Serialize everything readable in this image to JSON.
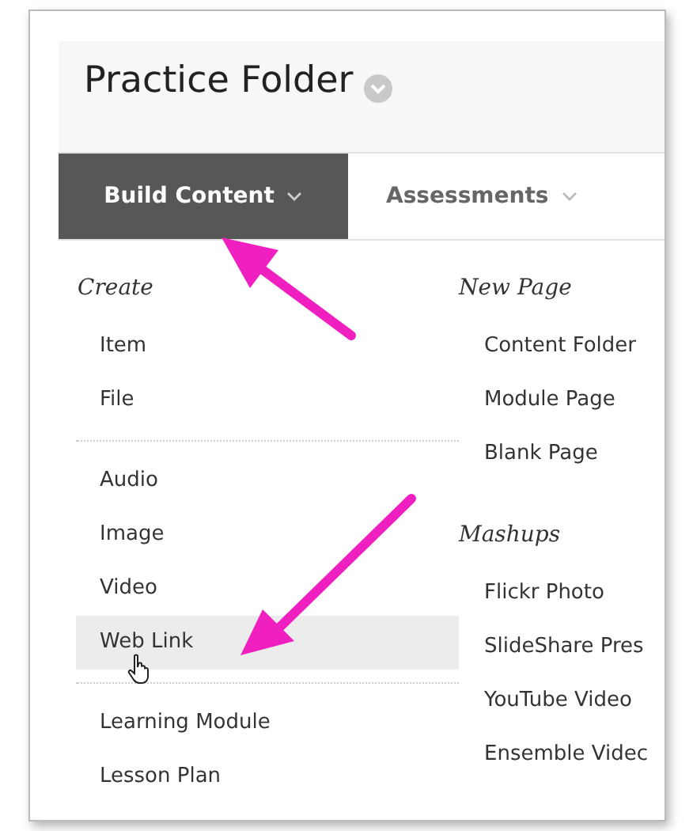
{
  "page": {
    "title": "Practice Folder"
  },
  "tabs": [
    {
      "label": "Build Content",
      "selected": true
    },
    {
      "label": "Assessments",
      "selected": false
    }
  ],
  "menu": {
    "columns": [
      {
        "divided": true,
        "sections": [
          {
            "heading": "Create",
            "items": [
              {
                "label": "Item",
                "hovered": false
              },
              {
                "label": "File",
                "hovered": false
              }
            ]
          },
          {
            "items": [
              {
                "label": "Audio",
                "hovered": false
              },
              {
                "label": "Image",
                "hovered": false
              },
              {
                "label": "Video",
                "hovered": false
              },
              {
                "label": "Web Link",
                "hovered": true
              }
            ]
          },
          {
            "items": [
              {
                "label": "Learning Module",
                "hovered": false
              },
              {
                "label": "Lesson Plan",
                "hovered": false
              }
            ]
          }
        ]
      },
      {
        "divided": false,
        "sections": [
          {
            "heading": "New Page",
            "items": [
              {
                "label": "Content Folder",
                "hovered": false
              },
              {
                "label": "Module Page",
                "hovered": false
              },
              {
                "label": "Blank Page",
                "hovered": false
              }
            ]
          },
          {
            "heading": "Mashups",
            "items": [
              {
                "label": "Flickr Photo",
                "hovered": false
              },
              {
                "label": "SlideShare Pres",
                "hovered": false
              },
              {
                "label": "YouTube Video",
                "hovered": false
              },
              {
                "label": "Ensemble Videc",
                "hovered": false
              }
            ]
          }
        ]
      }
    ]
  }
}
